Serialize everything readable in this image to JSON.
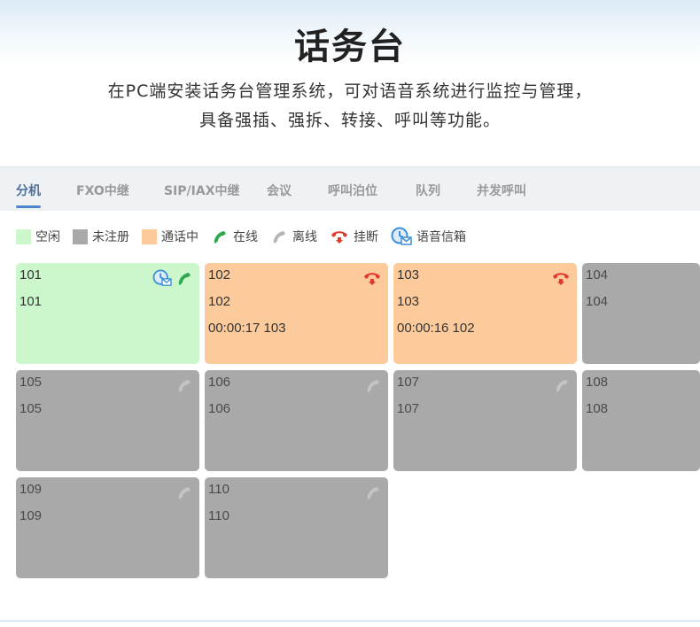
{
  "hero": {
    "title": "话务台",
    "desc_line1": "在PC端安装话务台管理系统，可对语音系统进行监控与管理，",
    "desc_line2": "具备强插、强拆、转接、呼叫等功能。"
  },
  "tabs": [
    {
      "label": "分机",
      "active": true
    },
    {
      "label": "FXO中继",
      "active": false
    },
    {
      "label": "SIP/IAX中继",
      "active": false
    },
    {
      "label": "会议",
      "active": false
    },
    {
      "label": "呼叫泊位",
      "active": false
    },
    {
      "label": "队列",
      "active": false
    },
    {
      "label": "并发呼叫",
      "active": false
    }
  ],
  "legend": [
    {
      "label": "空闲",
      "icon": "idle-swatch",
      "color": "#ccf7cc"
    },
    {
      "label": "未注册",
      "icon": "unregistered-swatch",
      "color": "#a9a9a9"
    },
    {
      "label": "通话中",
      "icon": "in-call-swatch",
      "color": "#fdca9b"
    },
    {
      "label": "在线",
      "icon": "phone-online-icon",
      "color": "#2fa84f"
    },
    {
      "label": "离线",
      "icon": "phone-offline-icon",
      "color": "#b5b5b5"
    },
    {
      "label": "挂断",
      "icon": "hangup-icon",
      "color": "#e03a2f"
    },
    {
      "label": "语音信箱",
      "icon": "voicemail-icon",
      "color": "#3d8fd6"
    }
  ],
  "extensions": [
    {
      "number": "101",
      "name": "101",
      "detail": "",
      "status": "idle",
      "icons": [
        "voicemail-icon",
        "phone-online-icon"
      ]
    },
    {
      "number": "102",
      "name": "102",
      "detail": "00:00:17 103",
      "status": "busy",
      "icons": [
        "hangup-icon"
      ]
    },
    {
      "number": "103",
      "name": "103",
      "detail": "00:00:16 102",
      "status": "busy",
      "icons": [
        "hangup-icon"
      ]
    },
    {
      "number": "104",
      "name": "104",
      "detail": "",
      "status": "unreg",
      "icons": []
    },
    {
      "number": "105",
      "name": "105",
      "detail": "",
      "status": "unreg",
      "icons": [
        "phone-offline-icon"
      ]
    },
    {
      "number": "106",
      "name": "106",
      "detail": "",
      "status": "unreg",
      "icons": [
        "phone-offline-icon"
      ]
    },
    {
      "number": "107",
      "name": "107",
      "detail": "",
      "status": "unreg",
      "icons": [
        "phone-offline-icon"
      ]
    },
    {
      "number": "108",
      "name": "108",
      "detail": "",
      "status": "unreg",
      "icons": []
    },
    {
      "number": "109",
      "name": "109",
      "detail": "",
      "status": "unreg",
      "icons": [
        "phone-offline-icon"
      ]
    },
    {
      "number": "110",
      "name": "110",
      "detail": "",
      "status": "unreg",
      "icons": [
        "phone-offline-icon"
      ]
    }
  ]
}
